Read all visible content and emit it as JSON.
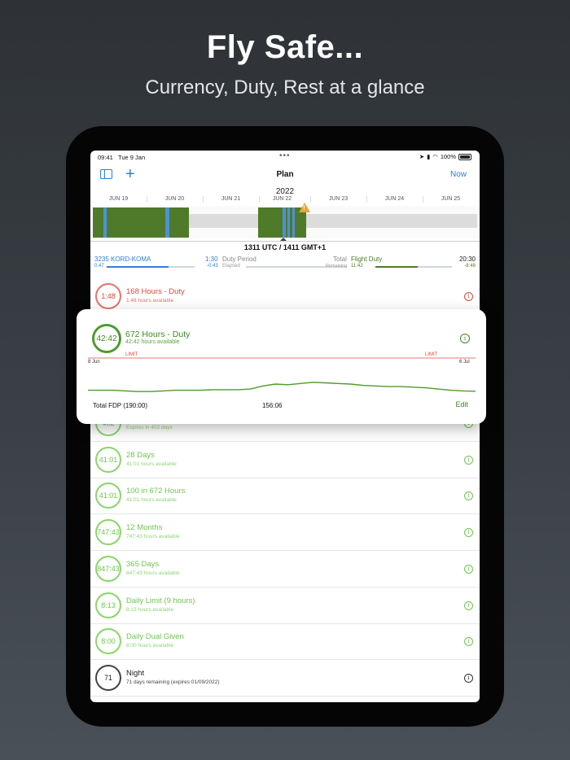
{
  "promo": {
    "headline": "Fly Safe...",
    "subhead": "Currency, Duty, Rest at a glance"
  },
  "status_bar": {
    "time": "09:41",
    "date": "Tue 9 Jan",
    "battery": "100%"
  },
  "nav": {
    "title": "Plan",
    "now_label": "Now",
    "add_glyph": "+"
  },
  "timeline": {
    "year": "2022",
    "days": [
      "JUN 19",
      "JUN 20",
      "JUN 21",
      "JUN 22",
      "JUN 23",
      "JUN 24",
      "JUN 25"
    ],
    "warning_icon": "warning-triangle-icon"
  },
  "utc_readout": "1311 UTC / 1411 GMT+1",
  "duty": {
    "flight": "3235 KORD-KOMA",
    "flight_sub": "0:47",
    "elapsed_value": "1:30",
    "elapsed_sub": "-0:43",
    "period_label": "Duty Period",
    "elapsed_label": "Elapsed",
    "total_label": "Total",
    "remaining_label": "Remaining",
    "remaining_sub": "11:42",
    "flight_duty_label": "Flight Duty",
    "end_value": "20:30",
    "end_sub": "-8:48",
    "flight_progress": 0.7,
    "elapsed_progress": 0.0,
    "flight_duty_progress": 0.55
  },
  "rows": [
    {
      "ring": "1:48",
      "title": "168 Hours - Duty",
      "sub": "1:48 hours available",
      "status": "red"
    },
    {
      "ring": "402",
      "title": "",
      "sub": "Expires in 402 days",
      "status": "green"
    },
    {
      "ring": "41:01",
      "title": "28 Days",
      "sub": "41:01 hours available",
      "status": "green"
    },
    {
      "ring": "41:01",
      "title": "100 in 672 Hours",
      "sub": "41:01 hours available",
      "status": "green"
    },
    {
      "ring": "747:43",
      "title": "12 Months",
      "sub": "747:43 hours available",
      "status": "green"
    },
    {
      "ring": "847:43",
      "title": "365 Days",
      "sub": "847:43 hours available",
      "status": "green"
    },
    {
      "ring": "8:13",
      "title": "Daily Limit (9 hours)",
      "sub": "8:13 hours available",
      "status": "green"
    },
    {
      "ring": "8:00",
      "title": "Daily Dual Given",
      "sub": "8:00 hours available",
      "status": "green"
    },
    {
      "ring": "71",
      "title": "Night",
      "sub": "71 days remaining (expires 01/09/2022)",
      "status": "dark"
    }
  ],
  "card": {
    "ring": "42:42",
    "title": "672 Hours - Duty",
    "sub": "42:42 hours available",
    "limit_label_left": "LIMIT",
    "limit_label_right": "LIMIT",
    "start_date": "8 Jun",
    "end_date": "6 Jul",
    "total_label": "Total FDP (190:00)",
    "total_value": "156:06",
    "edit_label": "Edit"
  },
  "chart_data": {
    "type": "line",
    "title": "672 Hours - Duty",
    "x_range": [
      "8 Jun",
      "6 Jul"
    ],
    "limit_line": "LIMIT",
    "series": [
      {
        "values": [
          0.22,
          0.22,
          0.22,
          0.2,
          0.18,
          0.18,
          0.2,
          0.22,
          0.22,
          0.22,
          0.24,
          0.24,
          0.24,
          0.26,
          0.36,
          0.42,
          0.4,
          0.44,
          0.48,
          0.46,
          0.44,
          0.42,
          0.38,
          0.36,
          0.34,
          0.34,
          0.32,
          0.3,
          0.26,
          0.22,
          0.2,
          0.19
        ]
      }
    ],
    "ylim": [
      0,
      1
    ],
    "colors": {
      "line": "#4f9a2f",
      "limit": "#e07a72"
    }
  },
  "colors": {
    "accent_blue": "#2f7de1",
    "duty_green": "#4e7a2a",
    "ok_green": "#6ec650",
    "alert_red": "#dc4a3e",
    "warning_orange": "#e7a43a"
  }
}
